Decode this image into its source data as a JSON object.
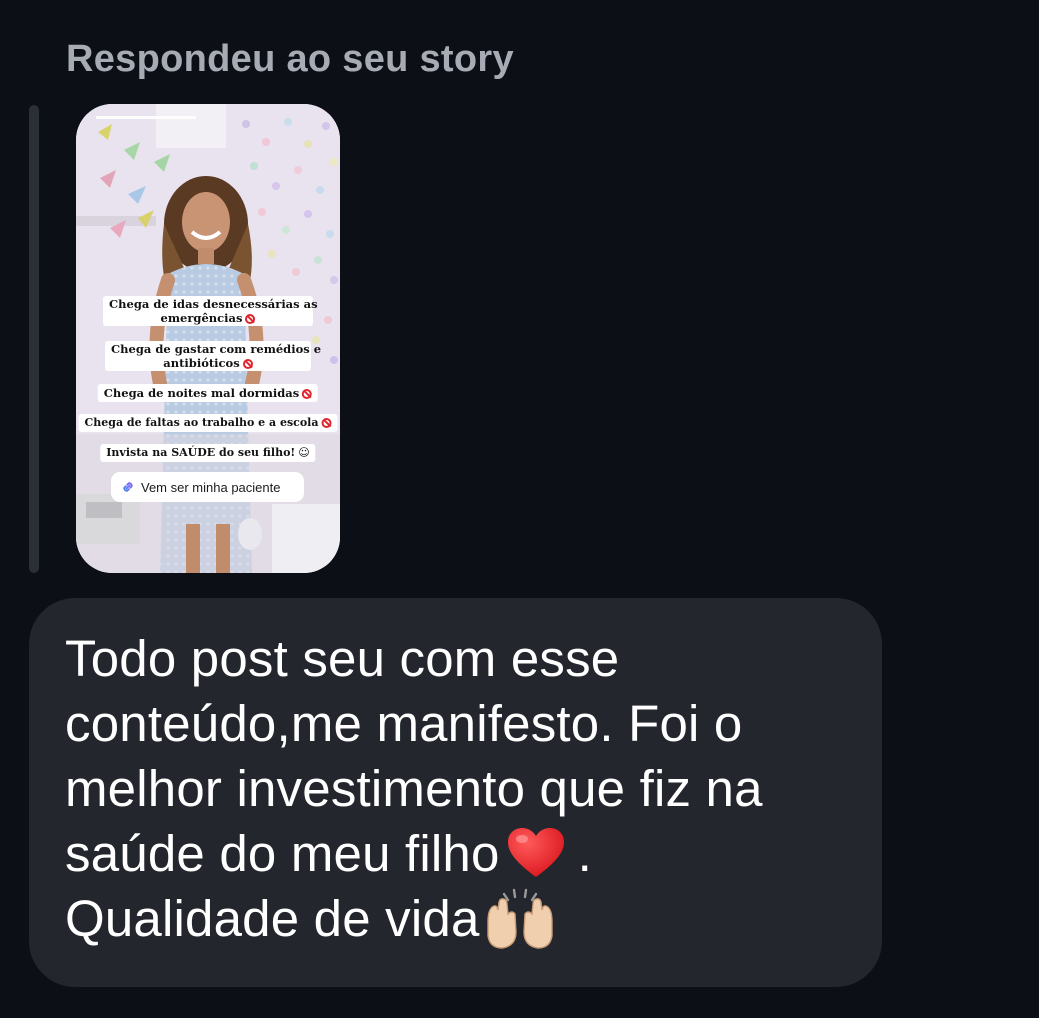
{
  "header": {
    "reply_label": "Respondeu ao seu story"
  },
  "story": {
    "captions": [
      "Chega de idas desnecessárias as",
      "emergências",
      "Chega de gastar com remédios e",
      "antibióticos",
      "Chega de noites mal dormidas",
      "Chega de faltas ao trabalho e a escola",
      "Invista na SAÚDE do seu filho!"
    ],
    "link_sticker": {
      "icon": "link-icon",
      "text": "Vem ser minha paciente"
    }
  },
  "message": {
    "line1": "Todo post seu com esse",
    "line2": "conteúdo,me manifesto. Foi o",
    "line3": "melhor investimento que fiz na",
    "line4_text": "saúde do meu filho",
    "line4_suffix": ".",
    "line5_text": "Qualidade de vida",
    "emojis": [
      "red-heart",
      "raising-hands"
    ]
  },
  "colors": {
    "background": "#0c0f15",
    "bubble": "#23262d",
    "header_text": "#a6abb4",
    "message_text": "#ffffff",
    "reply_bar": "#2b2f36"
  }
}
